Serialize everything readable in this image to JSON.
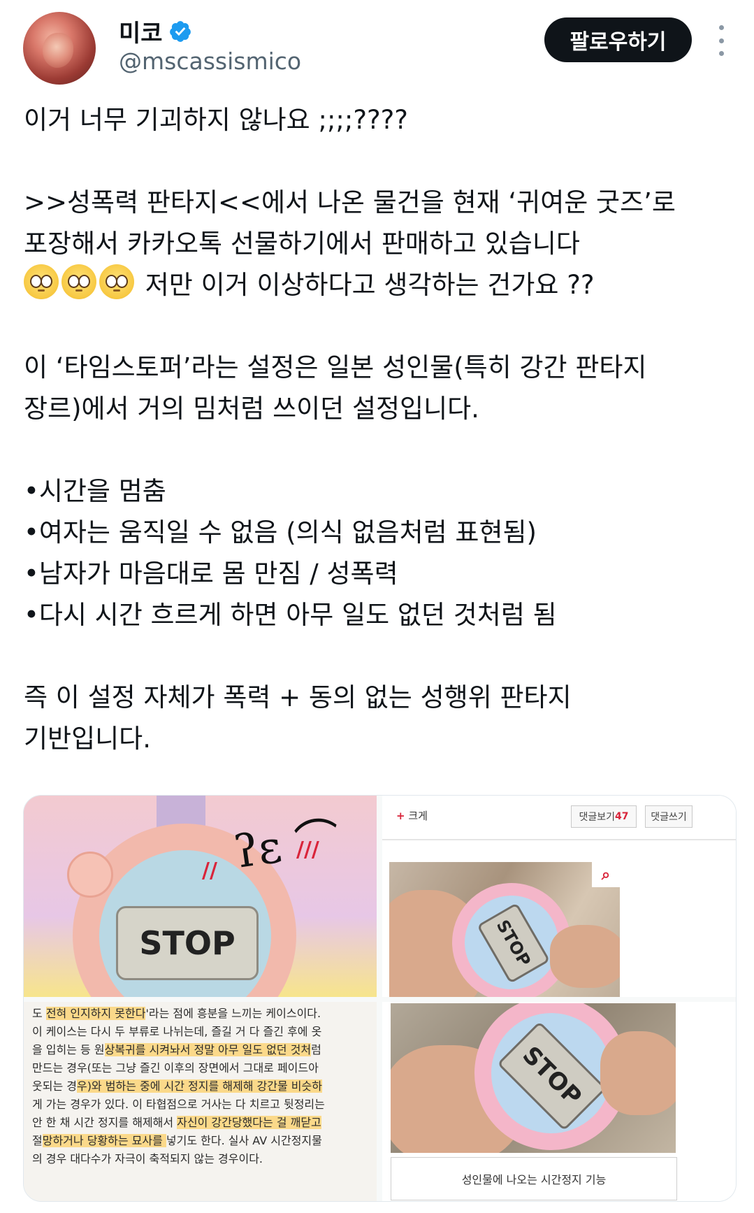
{
  "author": {
    "name": "미코",
    "handle": "@mscassismico",
    "verified": true
  },
  "actions": {
    "follow_label": "팔로우하기"
  },
  "tweet": {
    "lines": [
      "이거 너무 기괴하지 않나요 ;;;;????",
      ">>성폭력 판타지<<에서 나온 물건을 현재 ‘귀여운 굿즈’로",
      "포장해서 카카오톡 선물하기에서 판매하고 있습니다",
      "저만 이거 이상하다고 생각하는 건가요 ??",
      "이 ‘타임스토퍼’라는 설정은 일본 성인물(특히 강간 판타지",
      "장르)에서 거의 밈처럼 쓰이던 설정입니다.",
      "•시간을 멈춤",
      "•여자는 움직일 수 없음 (의식 없음처럼 표현됨)",
      "•남자가 마음대로 몸 만짐 / 성폭력",
      "•다시 시간 흐르게 하면 아무 일도 없던 것처럼 됨",
      "즉 이 설정 자체가 폭력 + 동의 없는 성행위 판타지",
      "기반입니다."
    ]
  },
  "media": {
    "toy_screen_text": "STOP",
    "webpage": {
      "bigger_label": "크게",
      "comments_view_label": "댓글보기",
      "comments_count": "47",
      "write_comment_label": "댓글쓰기"
    },
    "doc_lines": [
      "도 ",
      "전혀 인지하지 못한다",
      "'라는 점에 흥분을 느끼는 케이스이다.",
      "이 케이스는 다시 두 부류로 나뉘는데, 즐길 거 다 즐긴 후에 옷",
      "을 입히는 등 원",
      "상복귀를 시켜놔서 정말 아무 일도 없던 것처",
      "럼",
      "만드는 경우(또는 그냥 즐긴 이후의 장면에서 그대로 페이드아",
      "웃되는 경",
      "우)와 범하는 중에 시간 정지를 해제해 강간물 비슷하",
      "게 가는 경우가 있다. 이 타협점으로 거사는 다 치르고 뒷정리는",
      "안 한 채 시간 정지를 해제해서 ",
      "자신이 강간당했다는 걸 깨닫고",
      "절",
      "망하거나 당황하는 묘사를 ",
      "넣기도 한다. 실사 AV 시간정지물",
      "의 경우 대다수가 자극이 축적되지 않는 경우이다."
    ],
    "caption": "성인물에 나오는 시간정지 기능"
  },
  "colors": {
    "text": "#0f1419",
    "secondary": "#536471",
    "verified": "#1d9bf0",
    "button_bg": "#0f1419",
    "highlight": "#fbd98a"
  },
  "icons": [
    "verified-badge-icon",
    "more-options-icon",
    "eyes-emoji-icon",
    "magnifier-icon",
    "plus-icon"
  ]
}
